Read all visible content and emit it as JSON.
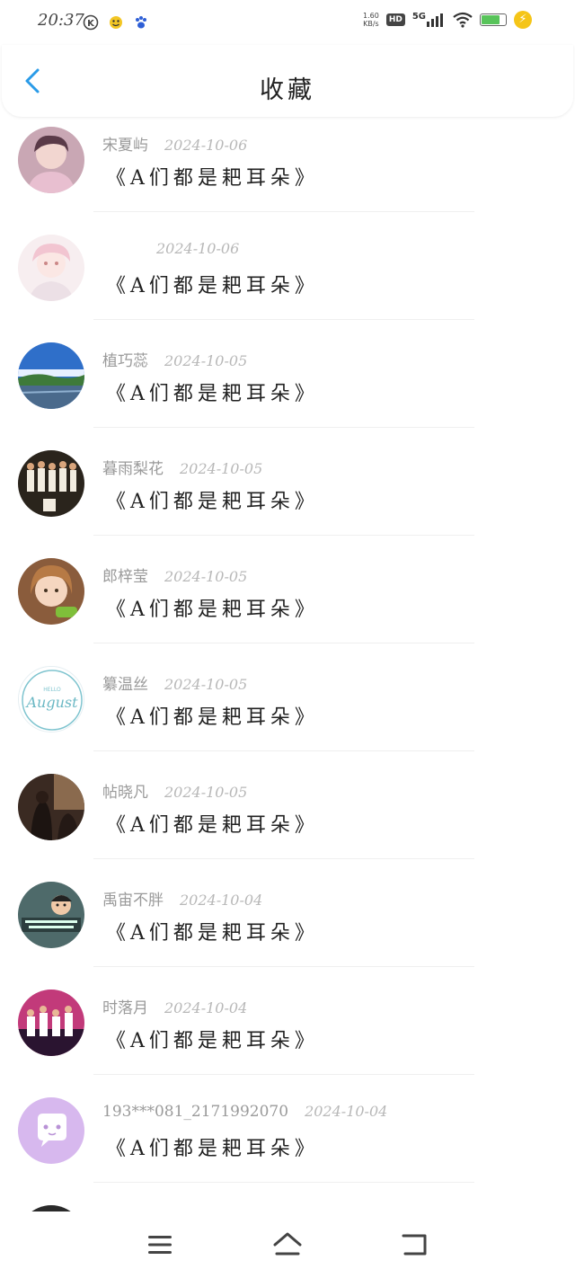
{
  "status_bar": {
    "time": "20:37",
    "net_speed_top": "1.60",
    "net_speed_bottom": "KB/s",
    "hd": "HD",
    "network": "5G",
    "charge": "⚡"
  },
  "header": {
    "title": "收藏"
  },
  "items": [
    {
      "name": "宋夏屿",
      "date": "2024-10-06",
      "title": "《A们都是耙耳朵》"
    },
    {
      "name": "",
      "date": "2024-10-06",
      "title": "《A们都是耙耳朵》"
    },
    {
      "name": "植巧蕊",
      "date": "2024-10-05",
      "title": "《A们都是耙耳朵》"
    },
    {
      "name": "暮雨梨花",
      "date": "2024-10-05",
      "title": "《A们都是耙耳朵》"
    },
    {
      "name": "郎梓莹",
      "date": "2024-10-05",
      "title": "《A们都是耙耳朵》"
    },
    {
      "name": "纂温丝",
      "date": "2024-10-05",
      "title": "《A们都是耙耳朵》"
    },
    {
      "name": "帖晓凡",
      "date": "2024-10-05",
      "title": "《A们都是耙耳朵》"
    },
    {
      "name": "禹宙不胖",
      "date": "2024-10-04",
      "title": "《A们都是耙耳朵》"
    },
    {
      "name": "时落月",
      "date": "2024-10-04",
      "title": "《A们都是耙耳朵》"
    },
    {
      "name": "193***081_2171992070",
      "date": "2024-10-04",
      "title": "《A们都是耙耳朵》"
    }
  ],
  "avatar_5_text": {
    "top": "HELLO",
    "main": "August"
  },
  "colors": {
    "accent": "#2a9be8",
    "meta_gray": "#9a9a9a",
    "title": "#222222"
  }
}
